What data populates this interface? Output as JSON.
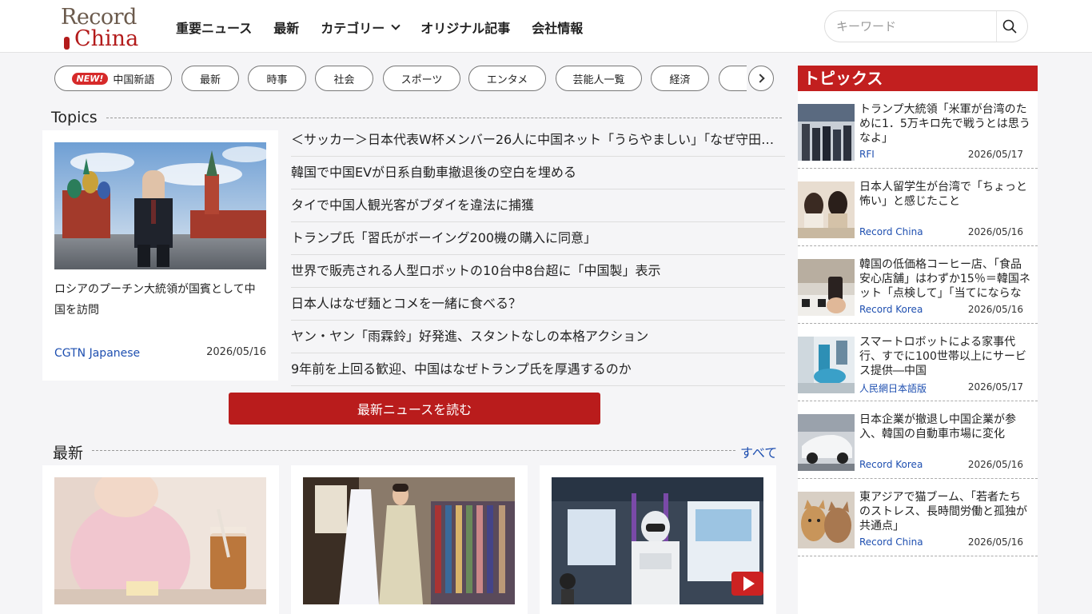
{
  "header": {
    "logo_line1": "Record",
    "logo_line2": "China",
    "nav": [
      "重要ニュース",
      "最新",
      "カテゴリー",
      "オリジナル記事",
      "会社情報"
    ],
    "search_placeholder": "キーワード"
  },
  "pills": {
    "new_badge": "NEW!",
    "items": [
      "中国新語",
      "最新",
      "時事",
      "社会",
      "スポーツ",
      "エンタメ",
      "芸能人一覧",
      "経済"
    ]
  },
  "topics": {
    "title": "Topics",
    "feature": {
      "title": "ロシアのプーチン大統領が国賓として中国を訪問",
      "source": "CGTN Japanese",
      "date": "2026/05/16"
    },
    "headlines": [
      "＜サッカー＞日本代表W杯メンバー26人に中国ネット「うらやましい」「なぜ守田…",
      "韓国で中国EVが日系自動車撤退後の空白を埋める",
      "タイで中国人観光客がブダイを違法に捕獲",
      "トランプ氏「習氏がボーイング200機の購入に同意」",
      "世界で販売される人型ロボットの10台中8台超に「中国製」表示",
      "日本人はなぜ麺とコメを一緒に食べる？",
      "ヤン・ヤン「雨霖鈴」好発進、スタントなしの本格アクション",
      "9年前を上回る歓迎、中国はなぜトランプ氏を厚遇するのか"
    ],
    "cta": "最新ニュースを読む"
  },
  "latest": {
    "title": "最新",
    "more": "すべて"
  },
  "sidebar": {
    "title": "トピックス",
    "items": [
      {
        "title": "トランプ大統領「米軍が台湾のために1．5万キロ先で戦うとは思うなよ」",
        "source": "RFI",
        "date": "2026/05/17"
      },
      {
        "title": "日本人留学生が台湾で「ちょっと怖い」と感じたこと",
        "source": "Record China",
        "date": "2026/05/16"
      },
      {
        "title": "韓国の低価格コーヒー店、「食品安心店舗」はわずか15％＝韓国ネット「点検して」「当てにならない」",
        "source": "Record Korea",
        "date": "2026/05/16"
      },
      {
        "title": "スマートロボットによる家事代行、すでに100世帯以上にサービス提供―中国",
        "source": "人民網日本語版",
        "date": "2026/05/17"
      },
      {
        "title": "日本企業が撤退し中国企業が参入、韓国の自動車市場に変化",
        "source": "Record Korea",
        "date": "2026/05/16"
      },
      {
        "title": "東アジアで猫ブーム、「若者たちのストレス、長時間労働と孤独が共通点」",
        "source": "Record China",
        "date": "2026/05/16"
      }
    ]
  },
  "colors": {
    "brand_red": "#b91c1c",
    "link_blue": "#1e4fb0"
  }
}
